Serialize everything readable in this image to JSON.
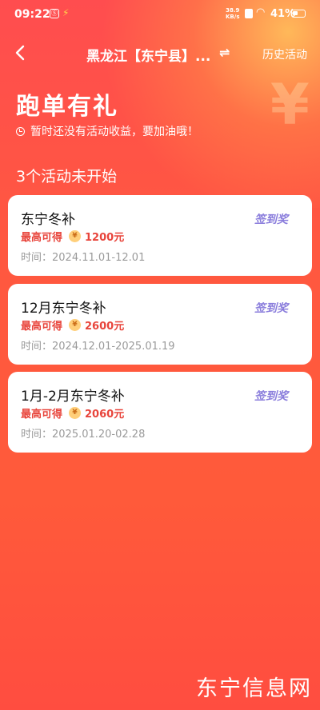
{
  "status_bar": {
    "time": "09:22",
    "app_icon": "Ⓢ",
    "network_speed_value": "38.9",
    "network_speed_unit": "KB/s",
    "battery": "41%"
  },
  "navbar": {
    "title": "黑龙江【东宁县】...",
    "swap_glyph": "⇌",
    "history_label": "历史活动"
  },
  "header": {
    "title": "跑单有礼",
    "subtitle": "暂时还没有活动收益，要加油哦！"
  },
  "section_title": "3个活动未开始",
  "activities": [
    {
      "name": "东宁冬补",
      "badge": "签到奖",
      "reward_label": "最高可得",
      "coin_symbol": "¥",
      "amount": "1200元",
      "time": "时间：2024.11.01-12.01"
    },
    {
      "name": "12月东宁冬补",
      "badge": "签到奖",
      "reward_label": "最高可得",
      "coin_symbol": "¥",
      "amount": "2600元",
      "time": "时间：2024.12.01-2025.01.19"
    },
    {
      "name": "1月-2月东宁冬补",
      "badge": "签到奖",
      "reward_label": "最高可得",
      "coin_symbol": "¥",
      "amount": "2060元",
      "time": "时间：2025.01.20-02.28"
    }
  ],
  "watermark": "东宁信息网",
  "colors": {
    "background": "#ff5340",
    "accent_red": "#e8453c",
    "badge_purple": "#8a7ddc",
    "coin": "#ffcf7a"
  }
}
